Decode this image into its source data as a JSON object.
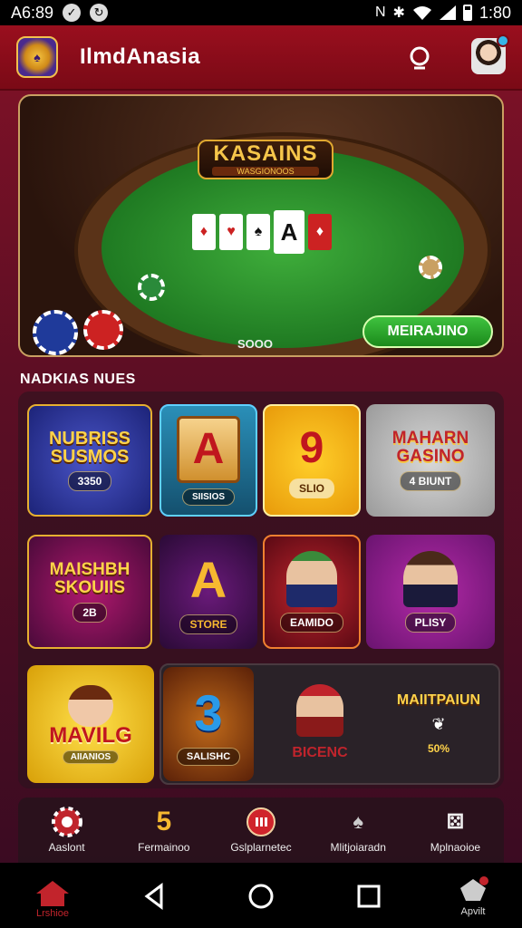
{
  "status_bar": {
    "time_left": "A6:89",
    "time_right": "1:80"
  },
  "app_bar": {
    "title": "IlmdAnasia"
  },
  "banner": {
    "title": "KASAINS",
    "subtitle": "WASGIONOOS",
    "pot": "SOOO",
    "cta": "MEIRAJINO"
  },
  "section": {
    "title": "NADKIAS NUES"
  },
  "games": [
    {
      "name": "NUBRISS SUSMOS",
      "pill": "3350"
    },
    {
      "name": "A",
      "pill": "SIISIOS"
    },
    {
      "name": "9",
      "pill": "SLIO"
    },
    {
      "name": "MAHARN GASINO",
      "pill": "4 BIUNT"
    },
    {
      "name": "MAISHBH SKOUIIS",
      "pill": "2B"
    },
    {
      "name": "A",
      "pill": "STORE"
    },
    {
      "name": "",
      "pill": "EAMIDO"
    },
    {
      "name": "",
      "pill": "PLISY"
    },
    {
      "name": "MAVILG",
      "pill": "AIIANIOS"
    },
    {
      "name": "3",
      "pill": "SALISHC"
    },
    {
      "name": "",
      "pill": "BICENC"
    },
    {
      "name": "MAIITPAIUN",
      "pill": "50%"
    }
  ],
  "bottom_nav": [
    {
      "label": "Aaslont",
      "icon": "roulette-icon"
    },
    {
      "label": "Fermainoo",
      "icon": "five-icon"
    },
    {
      "label": "Gslplarnetec",
      "icon": "red-chip-icon"
    },
    {
      "label": "Mlitjoiaradn",
      "icon": "spade-icon"
    },
    {
      "label": "Mplnaoioe",
      "icon": "dice-icon"
    }
  ],
  "system_nav": {
    "home_label": "Lrshioe",
    "app_label": "Apvilt"
  },
  "colors": {
    "app_bar": "#8f0d1c",
    "accent_green": "#2aa52a",
    "gold": "#f2c14e"
  }
}
